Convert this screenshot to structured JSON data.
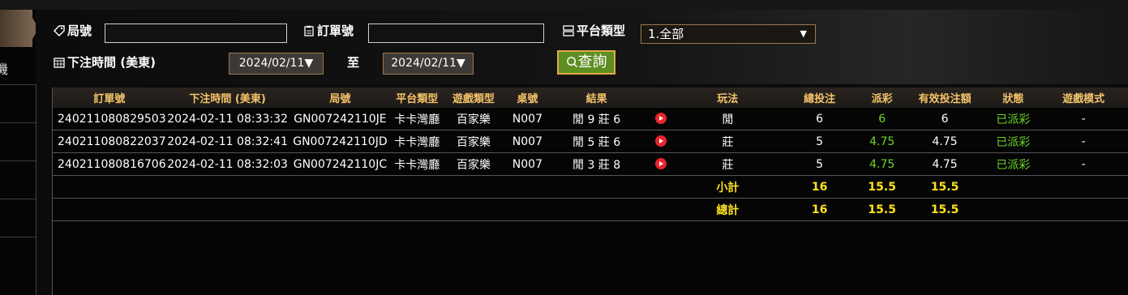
{
  "sidebar": {
    "active_label": "機"
  },
  "filters": {
    "game_no_label": "局號",
    "order_no_label": "訂單號",
    "platform_label": "平台類型",
    "platform_value": "1.全部",
    "bet_time_label": "下注時間 (美東)",
    "date_from": "2024/02/11",
    "date_to": "2024/02/11",
    "to_label": "至",
    "query_label": "查詢"
  },
  "table": {
    "headers": [
      "訂單號",
      "下注時間 (美東)",
      "局號",
      "平台類型",
      "遊戲類型",
      "桌號",
      "結果",
      "",
      "玩法",
      "總投注",
      "派彩",
      "有效投注額",
      "狀態",
      "遊戲模式"
    ],
    "rows": [
      {
        "order": "240211080829503",
        "time": "2024-02-11 08:33:32",
        "game": "GN007242110JE",
        "platform": "卡卡灣廳",
        "type": "百家樂",
        "table": "N007",
        "result": "閒 9 莊 6",
        "play": "閒",
        "bet": "6",
        "payout": "6",
        "valid": "6",
        "status": "已派彩",
        "mode": "-"
      },
      {
        "order": "240211080822037",
        "time": "2024-02-11 08:32:41",
        "game": "GN007242110JD",
        "platform": "卡卡灣廳",
        "type": "百家樂",
        "table": "N007",
        "result": "閒 5 莊 6",
        "play": "莊",
        "bet": "5",
        "payout": "4.75",
        "valid": "4.75",
        "status": "已派彩",
        "mode": "-"
      },
      {
        "order": "240211080816706",
        "time": "2024-02-11 08:32:03",
        "game": "GN007242110JC",
        "platform": "卡卡灣廳",
        "type": "百家樂",
        "table": "N007",
        "result": "閒 3 莊 8",
        "play": "莊",
        "bet": "5",
        "payout": "4.75",
        "valid": "4.75",
        "status": "已派彩",
        "mode": "-"
      }
    ],
    "subtotal": {
      "label": "小計",
      "bet": "16",
      "payout": "15.5",
      "valid": "15.5"
    },
    "total": {
      "label": "總計",
      "bet": "16",
      "payout": "15.5",
      "valid": "15.5"
    }
  },
  "colors": {
    "accent": "#f3c46a",
    "payout_green": "#6fd42a",
    "total_yellow": "#ffe21e",
    "query_btn": "#5e8e22"
  }
}
